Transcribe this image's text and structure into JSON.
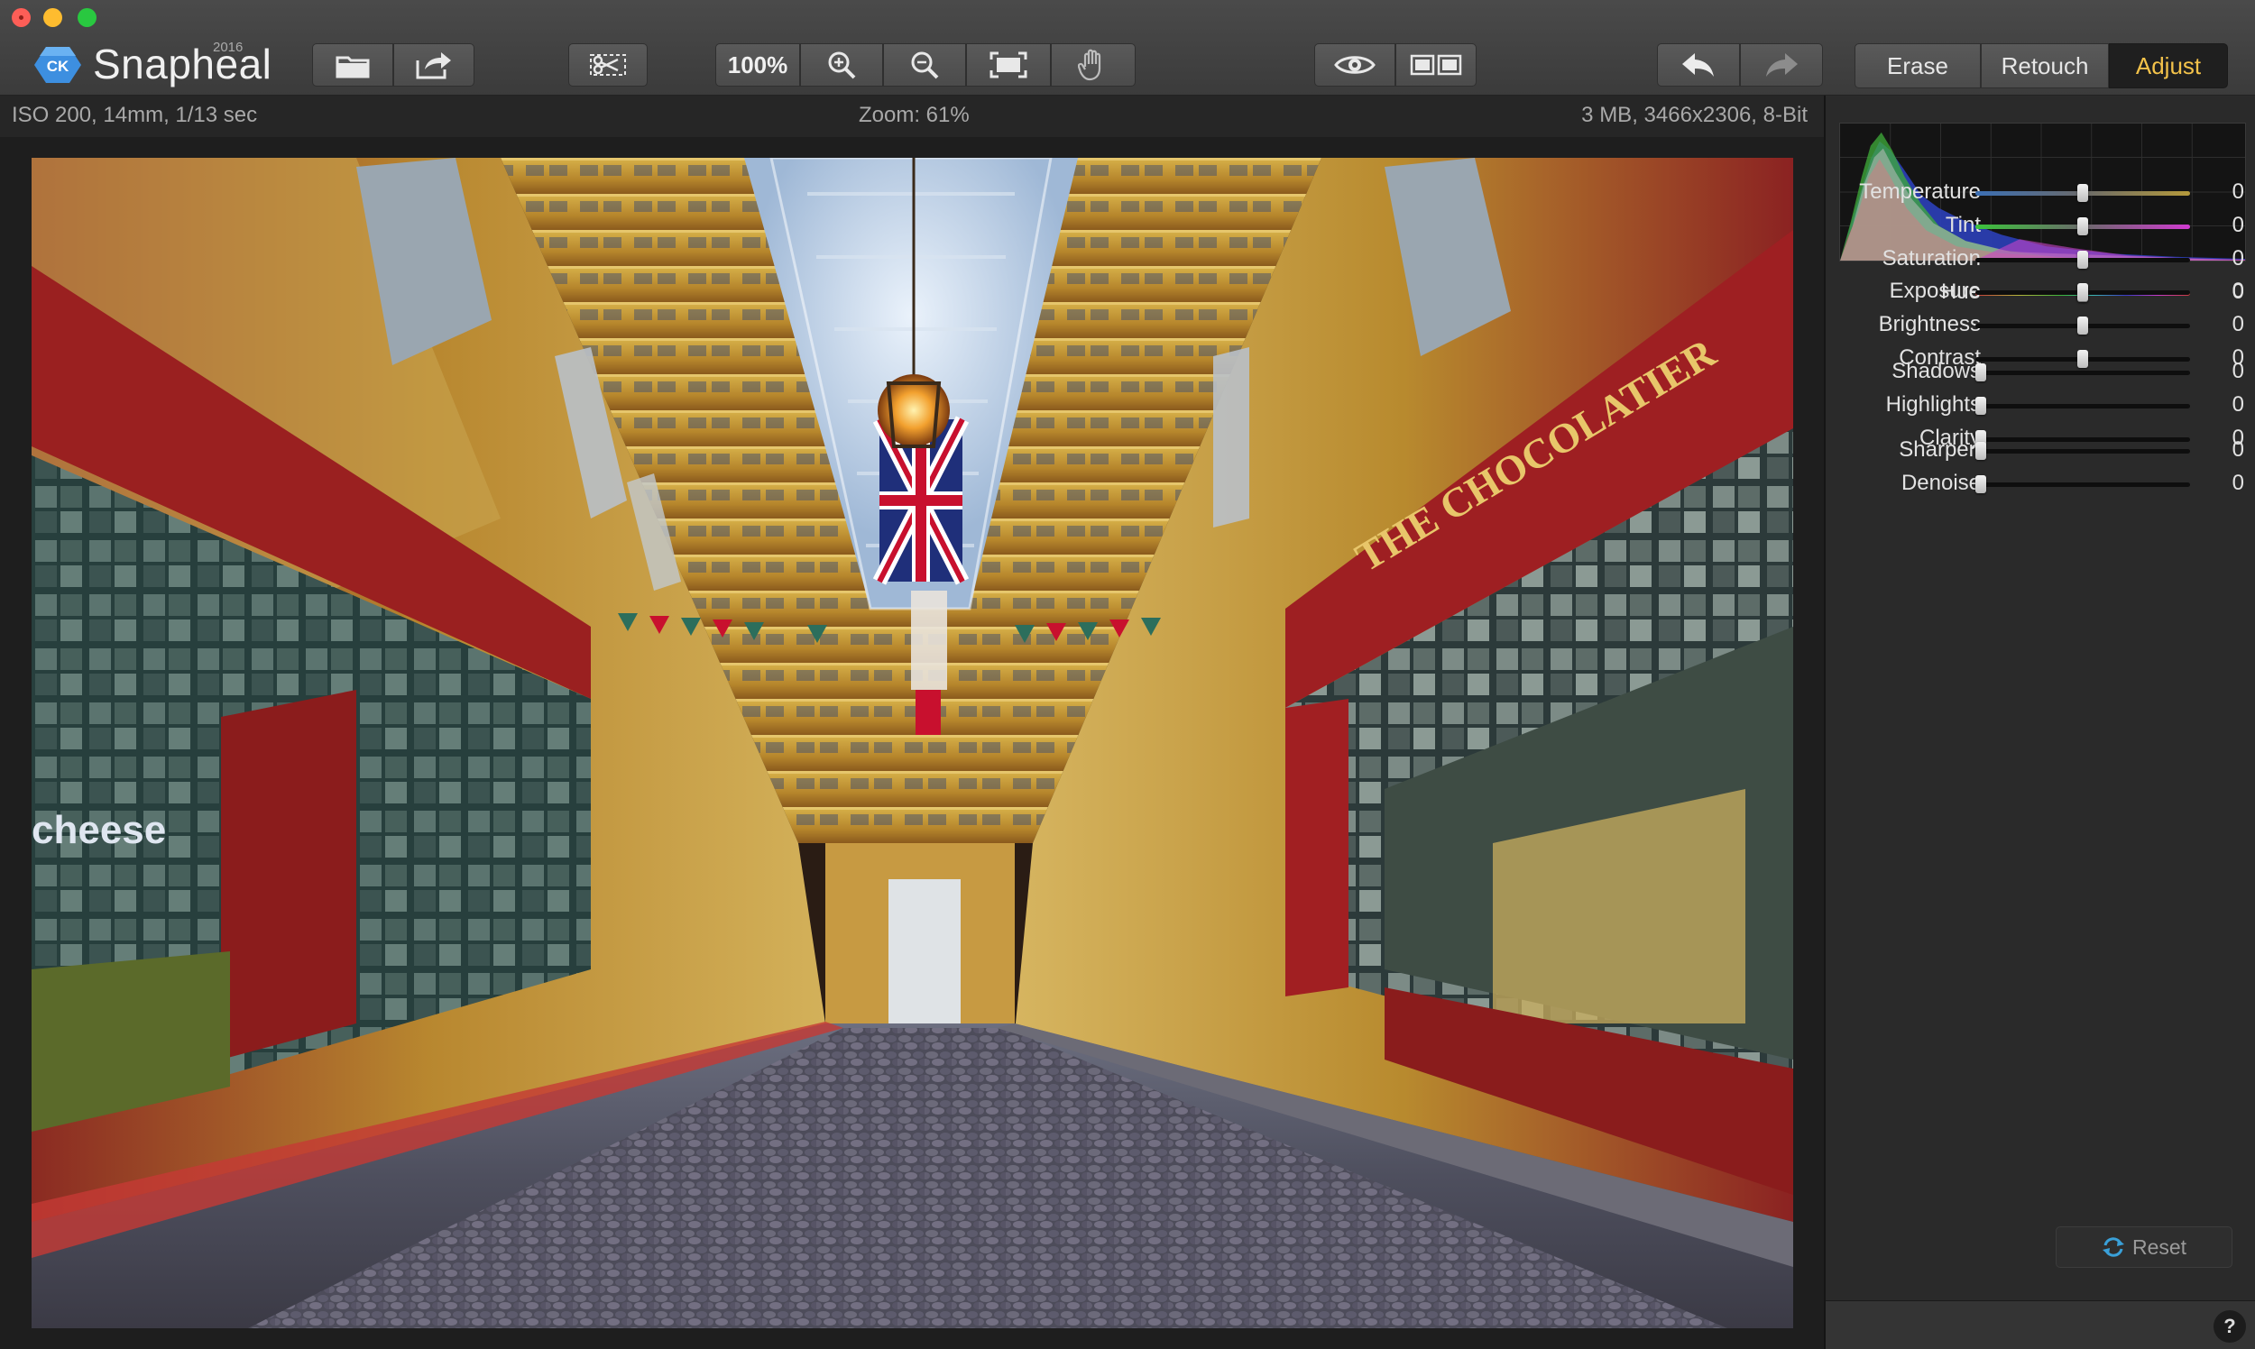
{
  "app": {
    "name": "Snapheal",
    "year": "2016",
    "badge": "CK"
  },
  "toolbar": {
    "zoom_100_label": "100%",
    "tabs": [
      {
        "label": "Erase",
        "active": false
      },
      {
        "label": "Retouch",
        "active": false
      },
      {
        "label": "Adjust",
        "active": true
      }
    ],
    "icons": [
      "open-folder-icon",
      "share-icon",
      "crop-scissors-icon",
      "zoom-in-icon",
      "zoom-out-icon",
      "fit-to-screen-icon",
      "hand-pan-icon",
      "preview-eye-icon",
      "compare-split-icon",
      "undo-arrow-icon",
      "redo-arrow-icon"
    ]
  },
  "infobar": {
    "camera": "ISO 200, 14mm, 1/13 sec",
    "zoom": "Zoom: 61%",
    "file": "3 MB, 3466x2306, 8-Bit"
  },
  "adjust": {
    "groups": [
      [
        {
          "label": "Temperature",
          "value": "0",
          "level": 0.5,
          "track": "temperature"
        },
        {
          "label": "Tint",
          "value": "0",
          "level": 0.5,
          "track": "tint"
        },
        {
          "label": "Saturation",
          "value": "0",
          "level": 0.5,
          "track": "plain"
        },
        {
          "label": "Hue",
          "value": "0",
          "level": 0.5,
          "track": "hue"
        }
      ],
      [
        {
          "label": "Exposure",
          "value": "0",
          "level": 0.5,
          "track": "plain"
        },
        {
          "label": "Brightness",
          "value": "0",
          "level": 0.5,
          "track": "plain"
        },
        {
          "label": "Contrast",
          "value": "0",
          "level": 0.5,
          "track": "plain"
        }
      ],
      [
        {
          "label": "Shadows",
          "value": "0",
          "level": 0,
          "track": "plain"
        },
        {
          "label": "Highlights",
          "value": "0",
          "level": 0,
          "track": "plain"
        },
        {
          "label": "Clarity",
          "value": "0",
          "level": 0,
          "track": "plain"
        }
      ],
      [
        {
          "label": "Sharpen",
          "value": "0",
          "level": 0,
          "track": "plain"
        },
        {
          "label": "Denoise",
          "value": "0",
          "level": 0,
          "track": "plain"
        }
      ]
    ],
    "reset_label": "Reset",
    "help_label": "?"
  },
  "colors": {
    "accent_active_tab": "#f3c24a",
    "panel_bg": "#2a2a2a",
    "toolbar_bg": "#444444"
  }
}
